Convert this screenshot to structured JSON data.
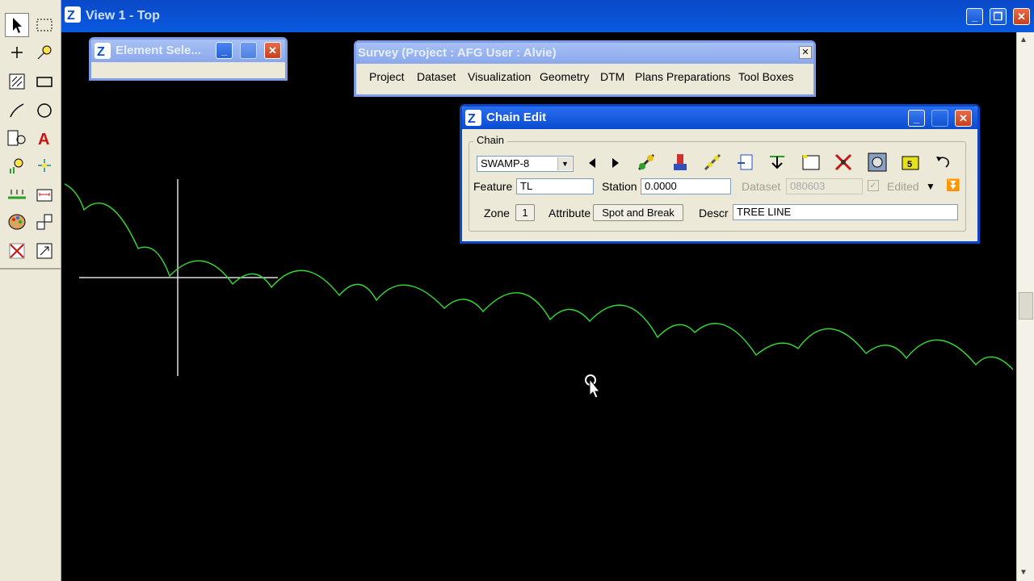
{
  "view_window": {
    "title": "View 1 - Top",
    "buttons": {
      "minimize": "_",
      "restore": "❐",
      "close": "✕"
    }
  },
  "element_selection_window": {
    "title": "Element Sele..."
  },
  "survey_window": {
    "title": "Survey (Project : AFG  User : Alvie)",
    "menu": [
      "Project",
      "Dataset",
      "Visualization",
      "Geometry",
      "DTM",
      "Plans Preparations",
      "Tool Boxes"
    ]
  },
  "chain_edit_window": {
    "title": "Chain Edit",
    "group_label": "Chain",
    "chain_select": "SWAMP-8",
    "feature_label": "Feature",
    "feature_value": "TL",
    "station_label": "Station",
    "station_value": "0.0000",
    "dataset_label": "Dataset",
    "dataset_value": "080603",
    "edited_label": "Edited",
    "zone_label": "Zone",
    "zone_value": "1",
    "attribute_label": "Attribute",
    "attribute_button": "Spot and Break",
    "descr_label": "Descr",
    "descr_value": "TREE LINE"
  },
  "colors": {
    "title_blue": "#0a4cd0",
    "canvas": "#000000",
    "tree_line": "#33dd33",
    "crosshair": "#dddddd"
  },
  "icons": [
    "selection-arrow-icon",
    "rectangle-select-icon",
    "place-point-icon",
    "bulb-point-icon",
    "fence-icon",
    "rectangle-icon",
    "line-icon",
    "circle-icon",
    "cell-icon",
    "text-icon",
    "bulb-icon",
    "snap-icon",
    "dimension-icon",
    "measure-icon",
    "palette-icon",
    "copy-icon",
    "delete-icon",
    "fit-view-icon"
  ]
}
